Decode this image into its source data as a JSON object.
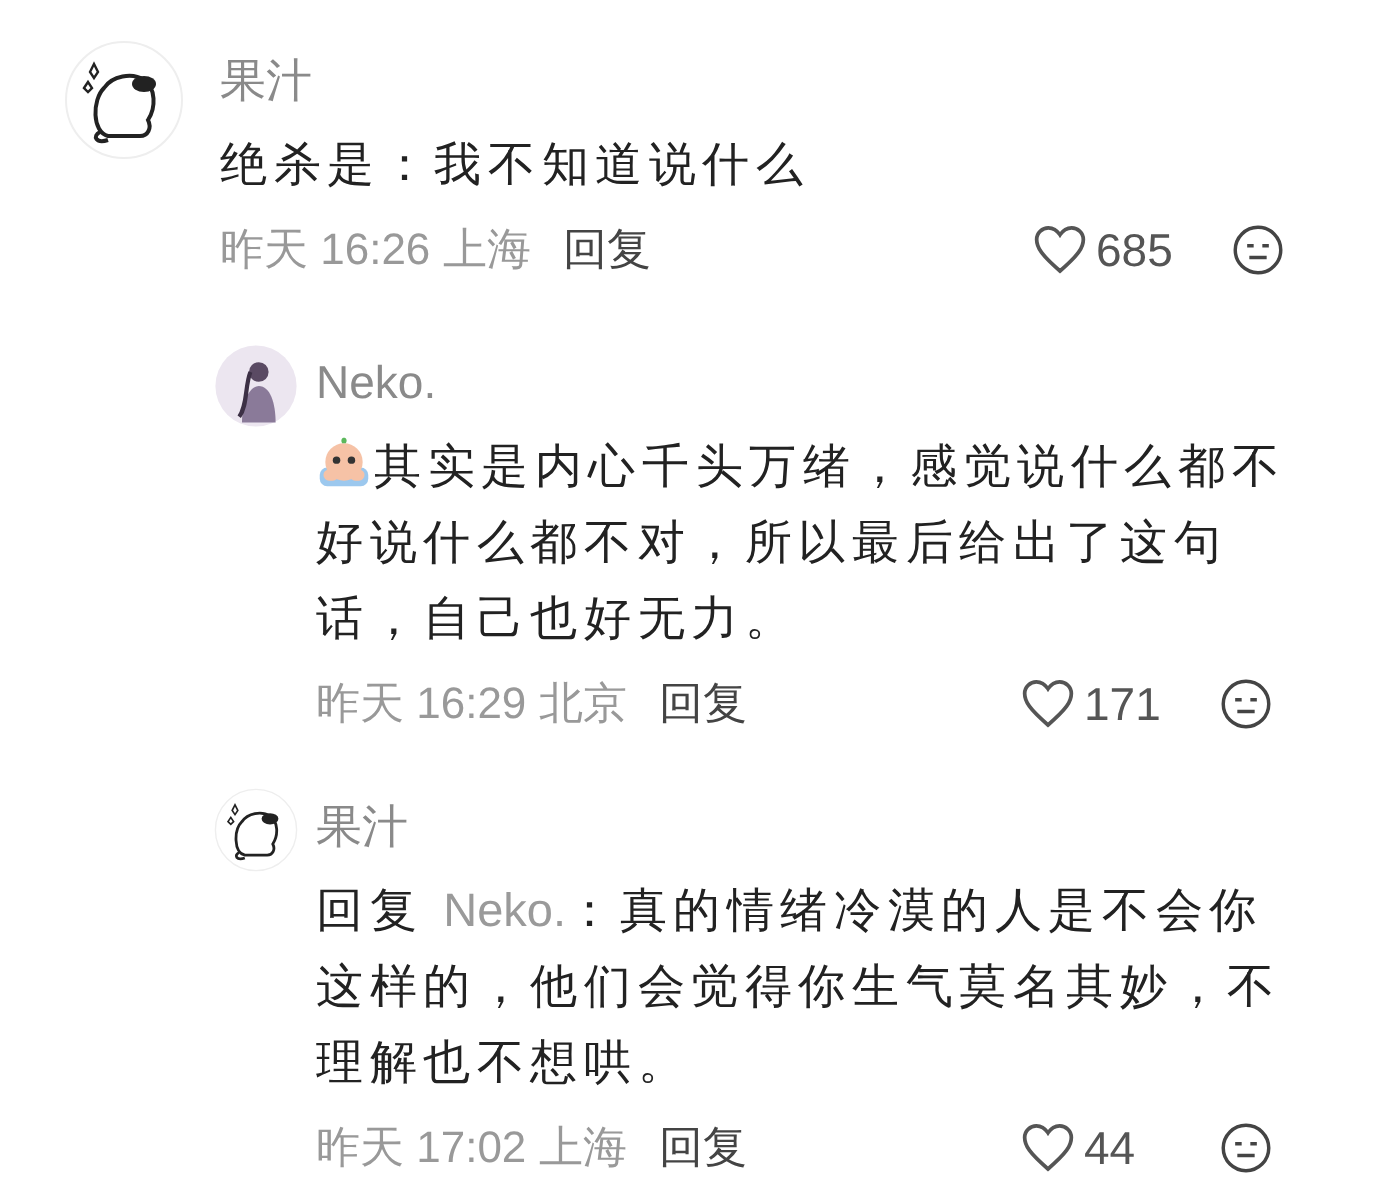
{
  "comments": [
    {
      "kind": "top",
      "avatar": {
        "kind": "pug"
      },
      "user": "果汁",
      "text": "绝杀是：我不知道说什么",
      "emoji": false,
      "time": "昨天 16:26 上海",
      "reply_label": "回复",
      "likes": "685"
    },
    {
      "kind": "reply",
      "avatar": {
        "kind": "figure"
      },
      "user": "Neko.",
      "emoji": true,
      "text": "其实是内心千头万绪，感觉说什么都不好说什么都不对，所以最后给出了这句话，自己也好无力。",
      "time": "昨天 16:29 北京",
      "reply_label": "回复",
      "likes": "171"
    },
    {
      "kind": "reply",
      "avatar": {
        "kind": "pug"
      },
      "user": "果汁",
      "emoji": false,
      "reply_prefix": "回复",
      "mention": "Neko.",
      "text": "：真的情绪冷漠的人是不会你这样的，他们会觉得你生气莫名其妙，不理解也不想哄。",
      "time": "昨天 17:02 上海",
      "reply_label": "回复",
      "likes": "44"
    }
  ]
}
